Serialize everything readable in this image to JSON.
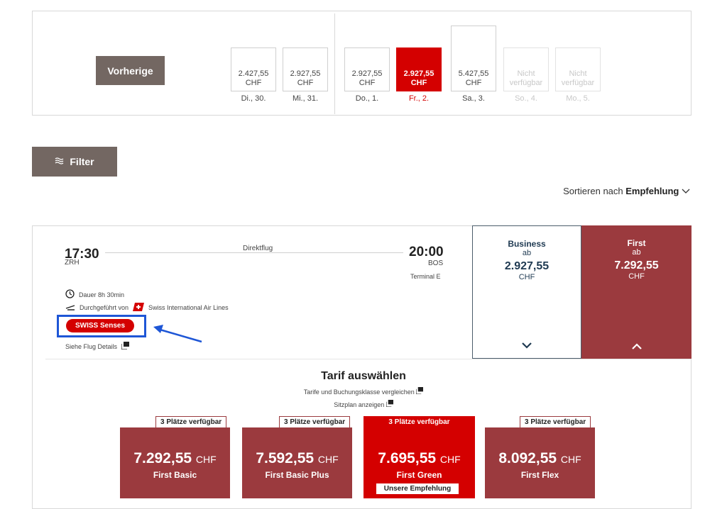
{
  "datebar": {
    "prev_label": "Vorherige",
    "days": [
      {
        "price": "2.427,55",
        "currency": "CHF",
        "label": "Di., 30.",
        "state": "normal"
      },
      {
        "price": "2.927,55",
        "currency": "CHF",
        "label": "Mi., 31.",
        "state": "normal"
      },
      {
        "price": "2.927,55",
        "currency": "CHF",
        "label": "Do., 1.",
        "state": "normal"
      },
      {
        "price": "2.927,55",
        "currency": "CHF",
        "label": "Fr., 2.",
        "state": "selected"
      },
      {
        "price": "5.427,55",
        "currency": "CHF",
        "label": "Sa., 3.",
        "state": "normal"
      },
      {
        "price": "Nicht",
        "currency": "verfügbar",
        "label": "So., 4.",
        "state": "unavailable"
      },
      {
        "price": "Nicht",
        "currency": "verfügbar",
        "label": "Mo., 5.",
        "state": "unavailable"
      }
    ]
  },
  "filter": {
    "label": "Filter"
  },
  "sort": {
    "prefix": "Sortieren nach",
    "value": "Empfehlung"
  },
  "flight": {
    "dep_time": "17:30",
    "dep_airport": "ZRH",
    "type": "Direktflug",
    "arr_time": "20:00",
    "arr_airport": "BOS",
    "terminal": "Terminal E",
    "duration": "Dauer  8h 30min",
    "operated_prefix": "Durchgeführt von",
    "operator": "Swiss International Air Lines",
    "badge": "SWISS Senses",
    "details_link": "Siehe Flug Details"
  },
  "cabins": {
    "business": {
      "name": "Business",
      "ab": "ab",
      "price": "2.927,55",
      "currency": "CHF"
    },
    "first": {
      "name": "First",
      "ab": "ab",
      "price": "7.292,55",
      "currency": "CHF"
    }
  },
  "tarif": {
    "title": "Tarif auswählen",
    "compare_link": "Tarife und Buchungsklasse vergleichen",
    "seatmap_link": "Sitzplan anzeigen"
  },
  "fares": [
    {
      "seats": "3 Plätze verfügbar",
      "price": "7.292,55",
      "currency": "CHF",
      "name": "First Basic"
    },
    {
      "seats": "3 Plätze verfügbar",
      "price": "7.592,55",
      "currency": "CHF",
      "name": "First Basic Plus"
    },
    {
      "seats": "3 Plätze verfügbar",
      "price": "7.695,55",
      "currency": "CHF",
      "name": "First Green",
      "recommendation": "Unsere Empfehlung"
    },
    {
      "seats": "3 Plätze verfügbar",
      "price": "8.092,55",
      "currency": "CHF",
      "name": "First Flex"
    }
  ],
  "colors": {
    "brand_red": "#d40000",
    "first_maroon": "#9b3a3e",
    "button_brown": "#736762",
    "annotation_blue": "#1e56d6"
  }
}
